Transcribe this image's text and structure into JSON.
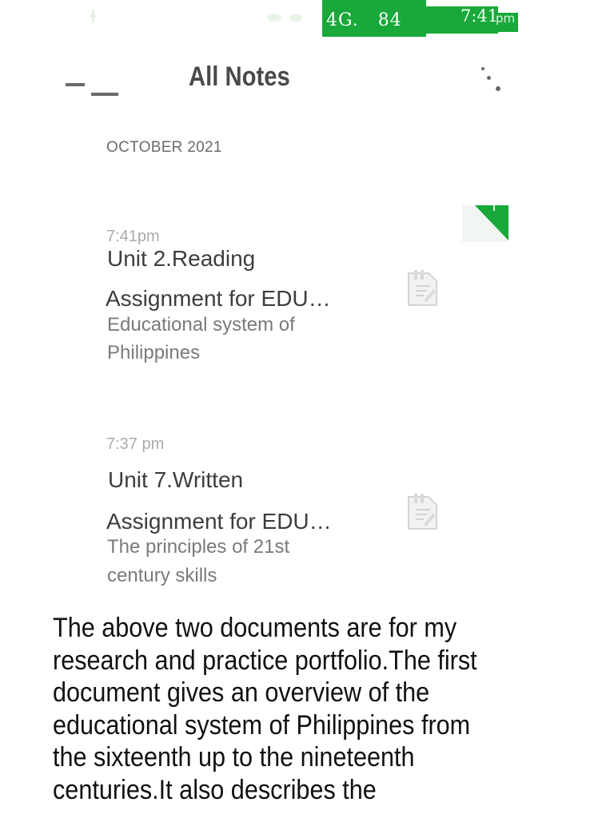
{
  "status_bar": {
    "network": "4G.",
    "battery": "84",
    "time": "7:41",
    "ampm": "pm",
    "accent_color": "#19a83a"
  },
  "header": {
    "title": "All Notes",
    "menu_icon": "hamburger-menu-icon",
    "more_icon": "more-dots-icon"
  },
  "notes_list": {
    "section_header": "OCTOBER 2021",
    "items": [
      {
        "time": "7:41pm",
        "title_line1": "Unit 2.Reading",
        "title_line2": "Assignment for EDU…",
        "snippet_line1": "Educational system of",
        "snippet_line2": "Philippines",
        "icon": "document-icon"
      },
      {
        "time": "7:37 pm",
        "title_line1": "Unit 7.Written",
        "title_line2": "Assignment for EDU…",
        "snippet_line1": "The principles of 21st",
        "snippet_line2": "century skills",
        "icon": "document-icon"
      }
    ]
  },
  "caption": {
    "lines": [
      "The above two documents are for my",
      "research and practice portfolio.The first",
      "document gives an overview of the",
      "educational system of Philippines from",
      "the sixteenth up to the nineteenth",
      "centuries.It also describes the"
    ]
  }
}
